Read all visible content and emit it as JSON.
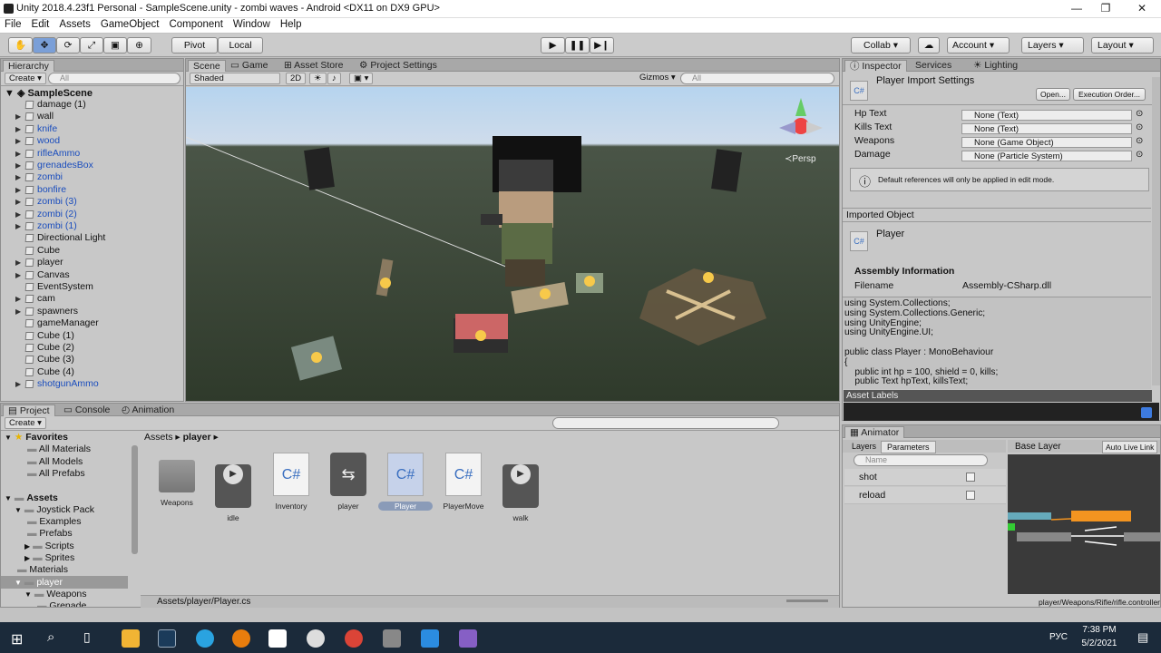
{
  "window": {
    "title": "Unity 2018.4.23f1 Personal - SampleScene.unity - zombi waves - Android <DX11 on DX9 GPU>",
    "min": "—",
    "max": "❐",
    "close": "✕"
  },
  "menu": [
    "File",
    "Edit",
    "Assets",
    "GameObject",
    "Component",
    "Window",
    "Help"
  ],
  "toolbar": {
    "pivot": "Pivot",
    "local": "Local",
    "collab": "Collab ▾",
    "account": "Account",
    "layers": "Layers",
    "layout": "Layout"
  },
  "hierarchy": {
    "tab": "Hierarchy",
    "create": "Create ▾",
    "search": "All",
    "scene": "SampleScene",
    "items": [
      {
        "label": "damage (1)",
        "arrow": "",
        "blue": false
      },
      {
        "label": "wall",
        "arrow": "▶",
        "blue": false
      },
      {
        "label": "knife",
        "arrow": "▶",
        "blue": true
      },
      {
        "label": "wood",
        "arrow": "▶",
        "blue": true
      },
      {
        "label": "rifleAmmo",
        "arrow": "▶",
        "blue": true
      },
      {
        "label": "grenadesBox",
        "arrow": "▶",
        "blue": true
      },
      {
        "label": "zombi",
        "arrow": "▶",
        "blue": true
      },
      {
        "label": "bonfire",
        "arrow": "▶",
        "blue": true
      },
      {
        "label": "zombi (3)",
        "arrow": "▶",
        "blue": true
      },
      {
        "label": "zombi (2)",
        "arrow": "▶",
        "blue": true
      },
      {
        "label": "zombi (1)",
        "arrow": "▶",
        "blue": true
      },
      {
        "label": "Directional Light",
        "arrow": "",
        "blue": false
      },
      {
        "label": "Cube",
        "arrow": "",
        "blue": false
      },
      {
        "label": "player",
        "arrow": "▶",
        "blue": false
      },
      {
        "label": "Canvas",
        "arrow": "▶",
        "blue": false
      },
      {
        "label": "EventSystem",
        "arrow": "",
        "blue": false
      },
      {
        "label": "cam",
        "arrow": "▶",
        "blue": false
      },
      {
        "label": "spawners",
        "arrow": "▶",
        "blue": false
      },
      {
        "label": "gameManager",
        "arrow": "",
        "blue": false
      },
      {
        "label": "Cube (1)",
        "arrow": "",
        "blue": false
      },
      {
        "label": "Cube (2)",
        "arrow": "",
        "blue": false
      },
      {
        "label": "Cube (3)",
        "arrow": "",
        "blue": false
      },
      {
        "label": "Cube (4)",
        "arrow": "",
        "blue": false
      },
      {
        "label": "shotgunAmmo",
        "arrow": "▶",
        "blue": true
      }
    ]
  },
  "scene": {
    "tabs": [
      "Scene",
      "Game",
      "Asset Store",
      "Project Settings"
    ],
    "shaded": "Shaded",
    "mode2d": "2D",
    "gizmos": "Gizmos ▾",
    "search": "All",
    "persp": "≺Persp"
  },
  "project": {
    "tabs": [
      "Project",
      "Console",
      "Animation"
    ],
    "create": "Create ▾",
    "tree": [
      {
        "label": "Favorites",
        "indent": 0,
        "bold": true,
        "arrow": "▼"
      },
      {
        "label": "All Materials",
        "indent": 2,
        "bold": false,
        "arrow": ""
      },
      {
        "label": "All Models",
        "indent": 2,
        "bold": false,
        "arrow": ""
      },
      {
        "label": "All Prefabs",
        "indent": 2,
        "bold": false,
        "arrow": ""
      },
      {
        "label": "",
        "indent": 0,
        "bold": false,
        "arrow": ""
      },
      {
        "label": "Assets",
        "indent": 0,
        "bold": true,
        "arrow": "▼"
      },
      {
        "label": "Joystick Pack",
        "indent": 1,
        "bold": false,
        "arrow": "▼"
      },
      {
        "label": "Examples",
        "indent": 2,
        "bold": false,
        "arrow": ""
      },
      {
        "label": "Prefabs",
        "indent": 2,
        "bold": false,
        "arrow": ""
      },
      {
        "label": "Scripts",
        "indent": 2,
        "bold": false,
        "arrow": "▶"
      },
      {
        "label": "Sprites",
        "indent": 2,
        "bold": false,
        "arrow": "▶"
      },
      {
        "label": "Materials",
        "indent": 1,
        "bold": false,
        "arrow": ""
      },
      {
        "label": "player",
        "indent": 1,
        "bold": false,
        "arrow": "▼"
      },
      {
        "label": "Weapons",
        "indent": 2,
        "bold": false,
        "arrow": "▼"
      },
      {
        "label": "Grenade",
        "indent": 3,
        "bold": false,
        "arrow": ""
      }
    ],
    "breadcrumb": [
      "Assets",
      "player"
    ],
    "assets": [
      {
        "label": "Weapons",
        "kind": "folder"
      },
      {
        "label": "idle",
        "kind": "anim"
      },
      {
        "label": "Inventory",
        "kind": "script"
      },
      {
        "label": "player",
        "kind": "controller"
      },
      {
        "label": "Player",
        "kind": "script"
      },
      {
        "label": "PlayerMove",
        "kind": "script"
      },
      {
        "label": "walk",
        "kind": "anim"
      }
    ],
    "path": "Assets/player/Player.cs"
  },
  "inspector": {
    "tabs": [
      "Inspector",
      "Services",
      "Lighting"
    ],
    "title": "Player Import Settings",
    "open": "Open...",
    "exec": "Execution Order...",
    "fields": [
      {
        "label": "Hp Text",
        "value": "None (Text)"
      },
      {
        "label": "Kills Text",
        "value": "None (Text)"
      },
      {
        "label": "Weapons",
        "value": "None (Game Object)"
      },
      {
        "label": "Damage",
        "value": "None (Particle System)"
      }
    ],
    "notice": "Default references will only be applied in edit mode.",
    "imported": "Imported Object",
    "obj": "Player",
    "asm_title": "Assembly Information",
    "filename_label": "Filename",
    "filename": "Assembly-CSharp.dll",
    "code": [
      "using System.Collections;",
      "using System.Collections.Generic;",
      "using UnityEngine;",
      "using UnityEngine.UI;",
      "",
      "public class Player : MonoBehaviour",
      "{",
      "    public int hp = 100, shield = 0, kills;",
      "    public Text hpText, killsText;"
    ],
    "asset_labels": "Asset Labels"
  },
  "animator": {
    "tab": "Animator",
    "layers": "Layers",
    "parameters": "Parameters",
    "search": "Name",
    "base_layer": "Base Layer",
    "auto": "Auto Live Link",
    "params": [
      "shot",
      "reload"
    ],
    "path": "player/Weapons/Rifle/rifle.controller"
  },
  "taskbar": {
    "lang": "РУС",
    "time": "7:38 PM",
    "date": "5/2/2021"
  },
  "colors": {
    "sky_top": "#7fb8e8",
    "ground": "#2f3a2b",
    "accent": "#3d7be0"
  }
}
